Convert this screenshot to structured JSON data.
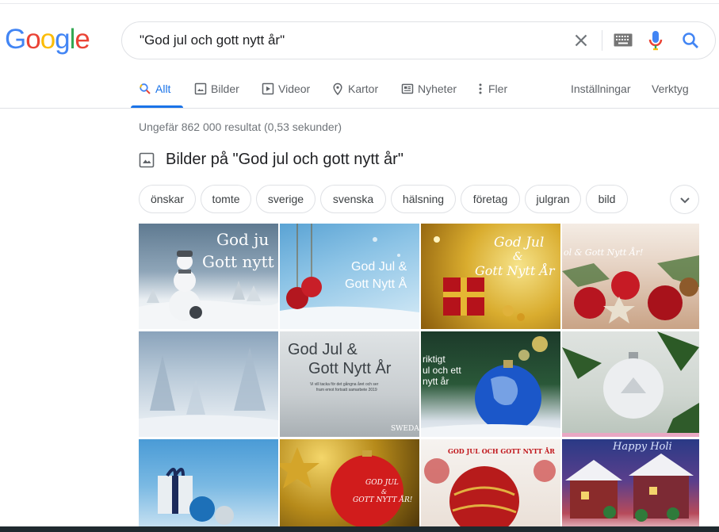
{
  "logo": {
    "letters": [
      "G",
      "o",
      "o",
      "g",
      "l",
      "e"
    ],
    "colors": [
      "#4285f4",
      "#ea4335",
      "#fbbc05",
      "#4285f4",
      "#34a853",
      "#ea4335"
    ]
  },
  "search": {
    "query": "\"God jul och gott nytt år\"",
    "icons": [
      "close-icon",
      "keyboard-icon",
      "mic-icon",
      "search-icon"
    ]
  },
  "tabs": [
    {
      "label": "Allt",
      "icon": "search-icon",
      "active": true
    },
    {
      "label": "Bilder",
      "icon": "image-icon"
    },
    {
      "label": "Videor",
      "icon": "play-icon"
    },
    {
      "label": "Kartor",
      "icon": "map-pin-icon"
    },
    {
      "label": "Nyheter",
      "icon": "news-icon"
    },
    {
      "label": "Fler",
      "icon": "more-vert-icon"
    }
  ],
  "tools": {
    "settings": "Inställningar",
    "tools": "Verktyg"
  },
  "results": {
    "stats": "Ungefär 862 000 resultat (0,53 sekunder)"
  },
  "images_section": {
    "title": "Bilder på \"God jul och gott nytt år\"",
    "chips": [
      "önskar",
      "tomte",
      "sverige",
      "svenska",
      "hälsning",
      "företag",
      "julgran",
      "bild"
    ],
    "captions": {
      "t1a": "God ju",
      "t1b": "Gott nytt",
      "t2a": "God Jul &",
      "t2b": "Gott Nytt Å",
      "t3a": "God Jul",
      "t3b": "&",
      "t3c": "Gott Nytt År",
      "t4": "ol & Gott Nytt År!",
      "t6a": "God Jul &",
      "t6b": "Gott Nytt År",
      "t6c": "Vi vill tacka för det gångna året och ser",
      "t6d": "fram emot fortsatt samarbete 2019",
      "t6e": "SWEDA",
      "t7a": "riktigt",
      "t7b": "ul och ett",
      "t7c": "nytt år",
      "t10a": "GOD JUL",
      "t10b": "&",
      "t10c": "GOTT NYTT ÅR!",
      "t11": "GOD JUL OCH GOTT NYTT ÅR",
      "t12": "Happy Holi"
    }
  }
}
